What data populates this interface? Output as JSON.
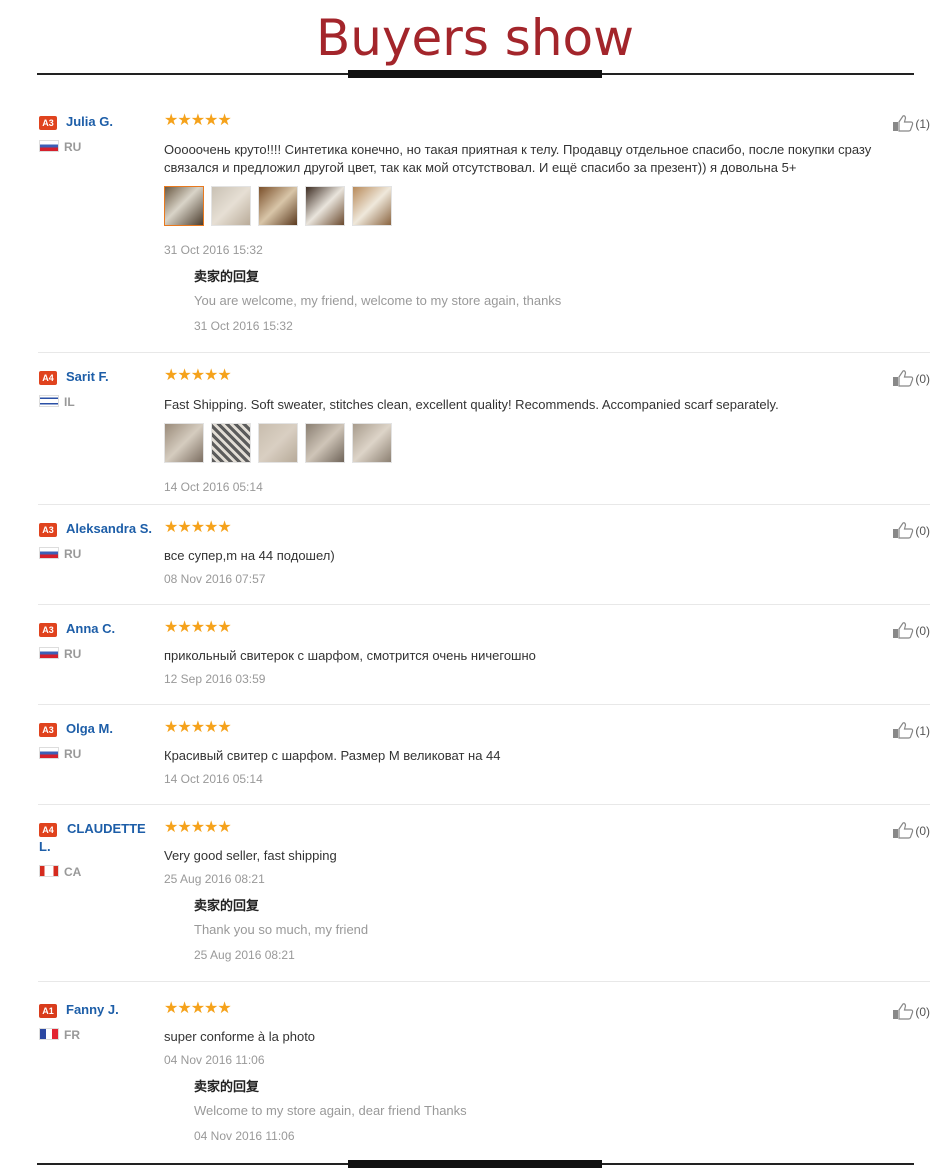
{
  "title": "Buyers show",
  "colors": {
    "title": "#a3252b",
    "name": "#1d5ea8",
    "stars": "#f5a21b",
    "badge": "#e0431e"
  },
  "reviews": [
    {
      "badge": "A3",
      "name": "Julia G.",
      "country": "RU",
      "flag": "ru-flag",
      "stars": "★★★★★",
      "rating": 5,
      "likes": "(1)",
      "text": "Ooooочень круто!!!! Синтетика конечно, но такая приятная к телу. Продавцу отдельное спасибо, после покупки сразу связался и предложил другой цвет, так как мой отсутствовал. И ещё спасибо за презент)) я довольна 5+",
      "photos": 5,
      "date": "31 Oct 2016 15:32",
      "reply": {
        "title": "卖家的回复",
        "text": "You are welcome, my friend, welcome to my store again, thanks",
        "date": "31 Oct 2016 15:32"
      }
    },
    {
      "badge": "A4",
      "name": "Sarit F.",
      "country": "IL",
      "flag": "il-flag",
      "stars": "★★★★★",
      "rating": 5,
      "likes": "(0)",
      "text": "Fast Shipping. Soft sweater, stitches clean, excellent quality! Recommends. Accompanied scarf separately.",
      "photos": 5,
      "date": "14 Oct 2016 05:14"
    },
    {
      "badge": "A3",
      "name": "Aleksandra S.",
      "country": "RU",
      "flag": "ru-flag",
      "stars": "★★★★★",
      "rating": 5,
      "likes": "(0)",
      "text": "все супер,m на 44 подошел)",
      "date": "08 Nov 2016 07:57"
    },
    {
      "badge": "A3",
      "name": "Anna C.",
      "country": "RU",
      "flag": "ru-flag",
      "stars": "★★★★★",
      "rating": 5,
      "likes": "(0)",
      "text": "прикольный свитерок с шарфом, смотрится очень ничегошно",
      "date": "12 Sep 2016 03:59"
    },
    {
      "badge": "A3",
      "name": "Olga M.",
      "country": "RU",
      "flag": "ru-flag",
      "stars": "★★★★★",
      "rating": 5,
      "likes": "(1)",
      "text": "Красивый свитер с шарфом. Размер М великоват на 44",
      "date": "14 Oct 2016 05:14"
    },
    {
      "badge": "A4",
      "name": "CLAUDETTE L.",
      "country": "CA",
      "flag": "ca-flag",
      "stars": "★★★★★",
      "rating": 5,
      "likes": "(0)",
      "text": "Very good seller, fast shipping",
      "date": "25 Aug 2016 08:21",
      "reply": {
        "title": "卖家的回复",
        "text": "Thank you so much, my friend",
        "date": "25 Aug 2016 08:21"
      }
    },
    {
      "badge": "A1",
      "name": "Fanny J.",
      "country": "FR",
      "flag": "fr-flag",
      "stars": "★★★★★",
      "rating": 5,
      "likes": "(0)",
      "text": "super conforme à la photo",
      "date": "04 Nov 2016 11:06",
      "reply": {
        "title": "卖家的回复",
        "text": "Welcome to my store again, dear friend Thanks",
        "date": "04 Nov 2016 11:06"
      }
    }
  ]
}
